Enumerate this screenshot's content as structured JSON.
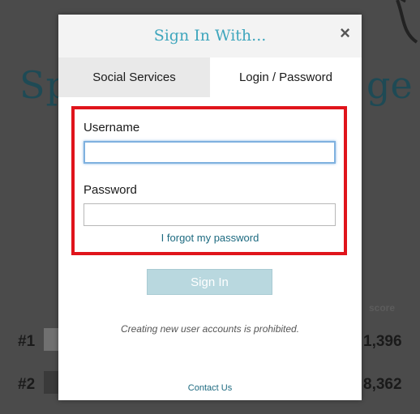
{
  "background": {
    "title_left": "Sp",
    "title_right": "ge",
    "score_label": "score",
    "rows": [
      {
        "rank": "#1",
        "score": "1,396"
      },
      {
        "rank": "#2",
        "score": "8,362"
      }
    ]
  },
  "modal": {
    "title": "Sign In With...",
    "close_label": "×",
    "tabs": [
      {
        "label": "Social Services"
      },
      {
        "label": "Login / Password"
      }
    ],
    "active_tab": "Login / Password",
    "username_label": "Username",
    "username_value": "",
    "password_label": "Password",
    "password_value": "",
    "forgot_password": "I forgot my password",
    "sign_in_label": "Sign In",
    "notice": "Creating new user accounts is prohibited.",
    "contact": "Contact Us"
  },
  "colors": {
    "title": "#3fa6bd",
    "highlight_border": "#e0141b",
    "button_bg": "#b9d8df",
    "link": "#1d6a80"
  }
}
